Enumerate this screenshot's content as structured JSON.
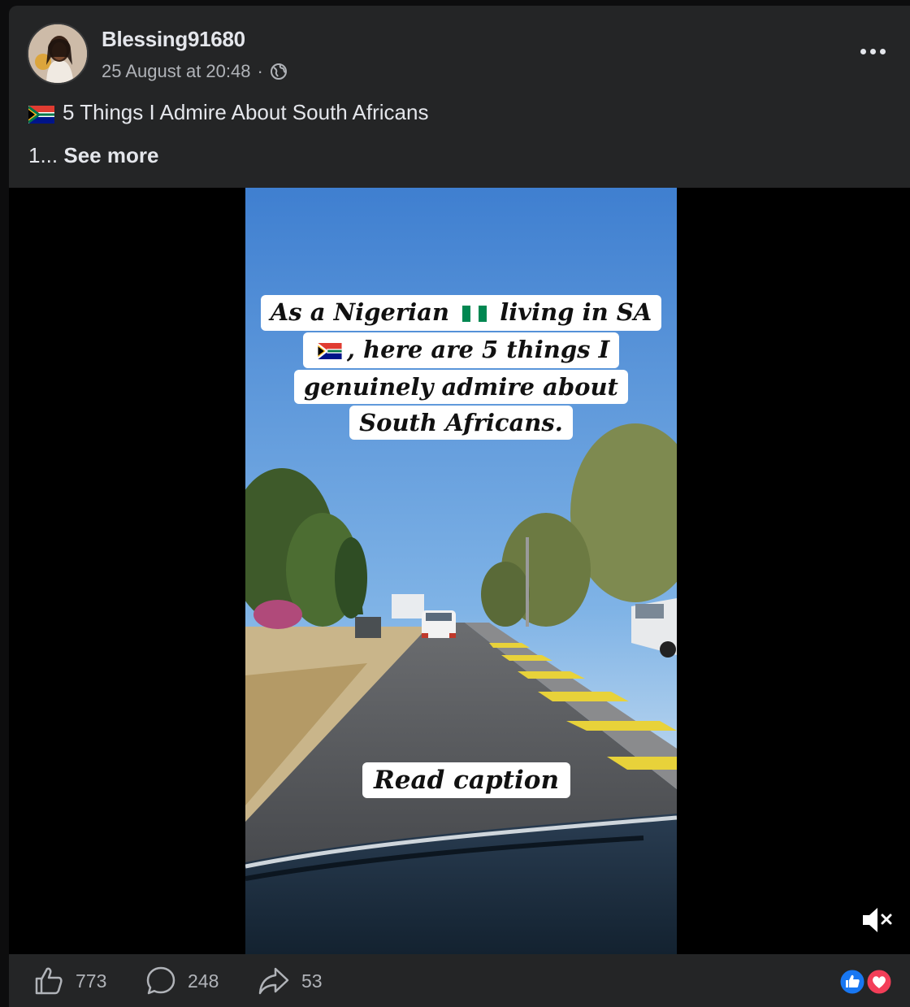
{
  "post": {
    "author": "Blessing91680",
    "timestamp": "25 August at 20:48",
    "separator": "·",
    "privacy_icon": "globe-icon",
    "title": "5 Things I Admire About South Africans",
    "body_prefix": "1... ",
    "see_more": "See more"
  },
  "video": {
    "caption_lines": [
      "As a Nigerian",
      "living in SA",
      ", here are 5 things I",
      "genuinely admire about",
      "South Africans."
    ],
    "read_caption": "Read caption",
    "muted": true
  },
  "actions": {
    "likes": "773",
    "comments": "248",
    "shares": "53"
  },
  "icons": {
    "like": "thumbs-up-icon",
    "comment": "comment-icon",
    "share": "share-icon",
    "mute": "speaker-muted-icon",
    "more": "more-options-icon"
  },
  "colors": {
    "card_bg": "#242526",
    "text_primary": "#e4e6eb",
    "text_secondary": "#b0b3b8",
    "like_blue": "#1877f2",
    "love_red": "#f33e58"
  }
}
